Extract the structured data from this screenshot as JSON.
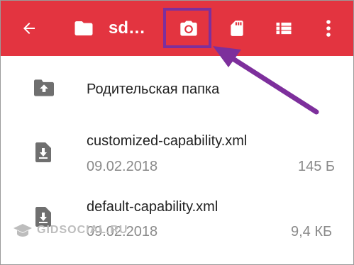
{
  "toolbar": {
    "title": "sd…",
    "icons": [
      "back-arrow-icon",
      "folder-icon",
      "camera-icon",
      "sd-card-icon",
      "list-view-icon",
      "more-vert-icon"
    ],
    "background": "#e33440"
  },
  "files": [
    {
      "name": "Родительская папка",
      "icon": "parent-folder-icon"
    },
    {
      "name": "customized-capability.xml",
      "date": "09.02.2018",
      "size": "145 Б",
      "icon": "file-download-icon"
    },
    {
      "name": "default-capability.xml",
      "date": "09.02.2018",
      "size": "9,4 КБ",
      "icon": "file-download-icon"
    }
  ],
  "annotation": {
    "color": "#7d2f9c"
  },
  "watermark": {
    "text": "GIDSOCIAL.RU"
  }
}
